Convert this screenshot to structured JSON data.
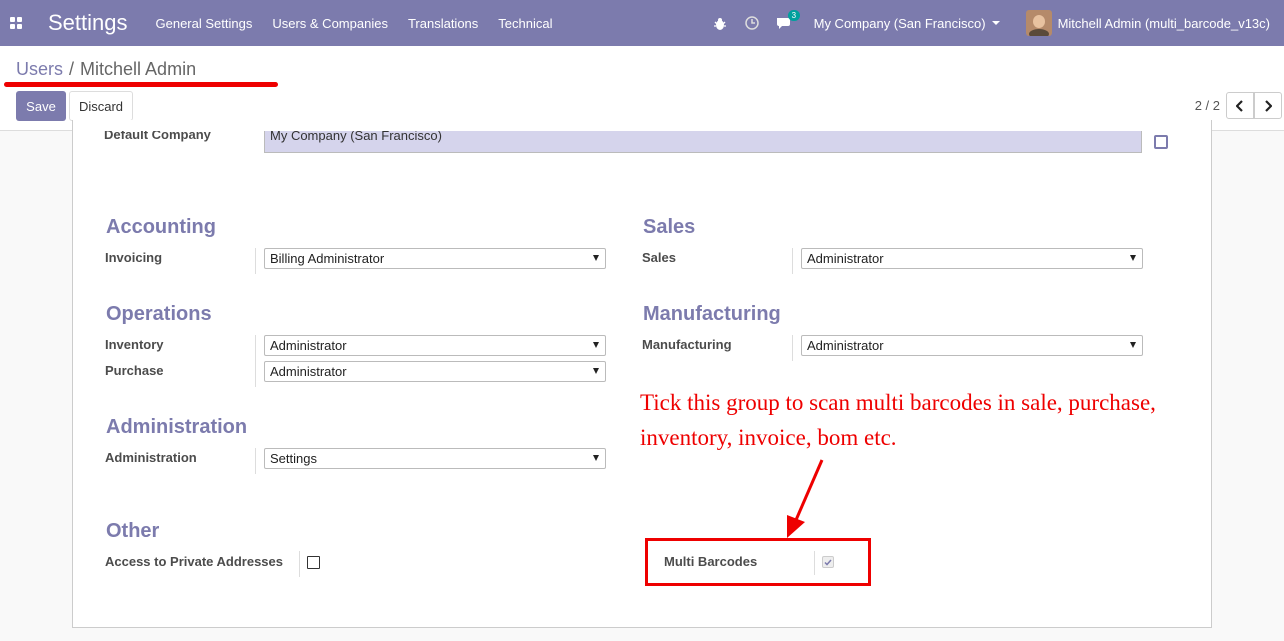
{
  "app": {
    "title": "Settings"
  },
  "menu": [
    "General Settings",
    "Users & Companies",
    "Translations",
    "Technical"
  ],
  "systray": {
    "messages_badge": "3",
    "company": "My Company (San Francisco)",
    "user": "Mitchell Admin (multi_barcode_v13c)"
  },
  "breadcrumb": {
    "parent": "Users",
    "separator": "/",
    "current": "Mitchell Admin"
  },
  "buttons": {
    "save": "Save",
    "discard": "Discard"
  },
  "pager": {
    "value": "2 / 2",
    "prev": "‹",
    "next": "›"
  },
  "clipped_row": {
    "label": "Default Company",
    "value": "My Company (San Francisco)"
  },
  "sections": {
    "accounting": {
      "title": "Accounting",
      "fields": [
        {
          "label": "Invoicing",
          "value": "Billing Administrator"
        }
      ]
    },
    "sales": {
      "title": "Sales",
      "fields": [
        {
          "label": "Sales",
          "value": "Administrator"
        }
      ]
    },
    "operations": {
      "title": "Operations",
      "fields": [
        {
          "label": "Inventory",
          "value": "Administrator"
        },
        {
          "label": "Purchase",
          "value": "Administrator"
        }
      ]
    },
    "manufacturing": {
      "title": "Manufacturing",
      "fields": [
        {
          "label": "Manufacturing",
          "value": "Administrator"
        }
      ]
    },
    "administration": {
      "title": "Administration",
      "fields": [
        {
          "label": "Administration",
          "value": "Settings"
        }
      ]
    },
    "other": {
      "title": "Other",
      "fields": [
        {
          "label": "Access to Private Addresses",
          "checked": false
        }
      ]
    }
  },
  "multi_barcodes": {
    "label": "Multi Barcodes",
    "checked": true
  },
  "annotation": {
    "line1": "Tick this group to scan multi barcodes in sale, purchase,",
    "line2": "inventory, invoice, bom etc.",
    "color": "#e00000"
  },
  "colors": {
    "brand": "#7c7bad",
    "annotation": "#e00000"
  }
}
